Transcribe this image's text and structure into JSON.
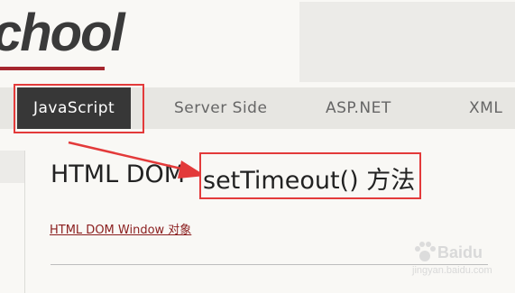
{
  "header": {
    "logo_text": "chool"
  },
  "nav": {
    "items": [
      {
        "label": "JavaScript",
        "active": true
      },
      {
        "label": "Server Side",
        "active": false
      },
      {
        "label": "ASP.NET",
        "active": false
      },
      {
        "label": "XML",
        "active": false
      }
    ]
  },
  "main": {
    "title_prefix": "HTML DOM",
    "title_method": "setTimeout() 方法",
    "window_link": "HTML DOM Window 对象"
  },
  "watermark": {
    "brand": "Baidu",
    "url": "jingyan.baidu.com"
  },
  "colors": {
    "annotation_red": "#e33a3a",
    "nav_active_bg": "#373737",
    "logo_underline": "#a5262e",
    "link": "#8a1d1d"
  }
}
